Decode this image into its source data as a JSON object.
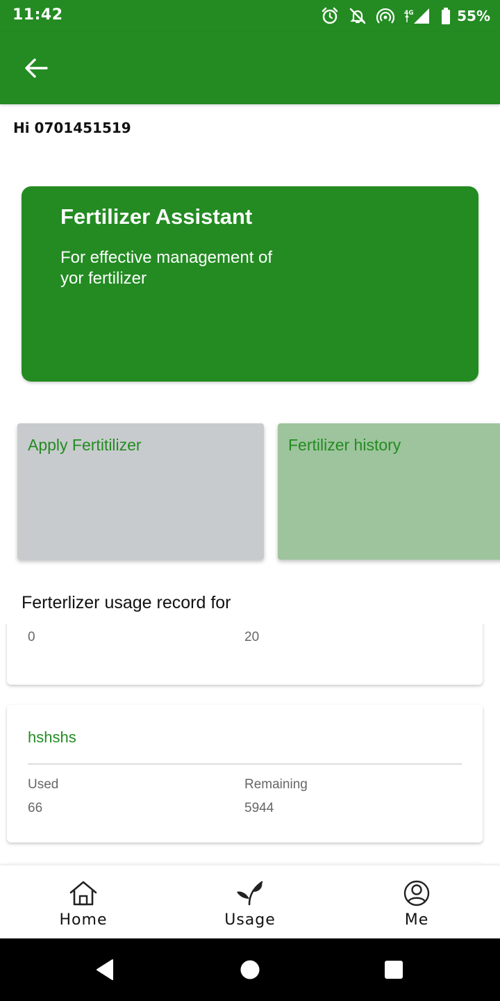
{
  "status_bar": {
    "time": "11:42",
    "battery": "55%",
    "icons": [
      "alarm-icon",
      "notifications-off-icon",
      "hotspot-icon",
      "signal-4g-icon",
      "battery-icon"
    ]
  },
  "app_bar": {
    "back_icon": "arrow-left-icon",
    "background": "#238b22"
  },
  "greeting": "Hi 0701451519",
  "hero": {
    "title": "Fertilizer Assistant",
    "subtitle": "For effective management of yor fertilizer"
  },
  "actions": {
    "apply_label": "Apply Fertitilizer",
    "history_label": "Fertilizer history"
  },
  "usage": {
    "section_title": "Ferterlizer usage record for",
    "used_label": "Used",
    "remaining_label": "Remaining",
    "records": [
      {
        "name": "",
        "used": "0",
        "remaining": "20"
      },
      {
        "name": "hshshs",
        "used": "66",
        "remaining": "5944"
      }
    ]
  },
  "bottom_nav": {
    "items": [
      {
        "label": "Home",
        "icon": "home-icon"
      },
      {
        "label": "Usage",
        "icon": "plant-icon"
      },
      {
        "label": "Me",
        "icon": "profile-icon"
      }
    ]
  },
  "colors": {
    "brand_green": "#238b22",
    "history_tile": "#9dc49c",
    "apply_tile": "#c8cbcd"
  }
}
